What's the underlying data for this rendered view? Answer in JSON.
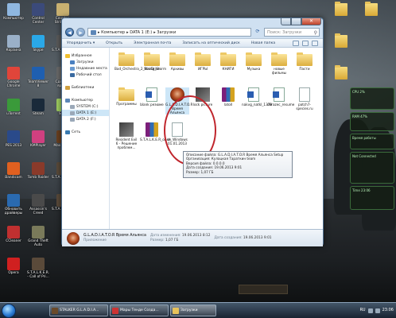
{
  "desktop_icons": [
    {
      "label": "Компьютер",
      "icon": "computer-icon"
    },
    {
      "label": "Control Center",
      "icon": "control-center-icon"
    },
    {
      "label": "Counter-Strike 1.6",
      "icon": "cs-icon"
    },
    {
      "label": "Корзина",
      "icon": "recycle-bin-icon"
    },
    {
      "label": "Skype",
      "icon": "skype-icon"
    },
    {
      "label": "S.T.A.L.K.E.R.",
      "icon": "stalker-icon"
    },
    {
      "label": "Google Chrome",
      "icon": "chrome-icon"
    },
    {
      "label": "TeamViewer 8",
      "icon": "teamviewer-icon"
    },
    {
      "label": "Сделать ярлык",
      "icon": "shortcut-icon"
    },
    {
      "label": "uTorrent",
      "icon": "utorrent-icon"
    },
    {
      "label": "Steam",
      "icon": "steam-icon"
    },
    {
      "label": "Sims",
      "icon": "sims-icon"
    },
    {
      "label": "PES 2013",
      "icon": "pes-icon"
    },
    {
      "label": "KMPlayer",
      "icon": "kmplayer-icon"
    },
    {
      "label": "Max Payne",
      "icon": "maxpayne-icon"
    },
    {
      "label": "Bandicam",
      "icon": "bandicam-icon"
    },
    {
      "label": "Tomb Raider",
      "icon": "tombraider-icon"
    },
    {
      "label": "S.T.A.L.K.E.R.",
      "icon": "stalker2-icon"
    },
    {
      "label": "Обновить драйверы",
      "icon": "drivers-icon"
    },
    {
      "label": "Assassin's Creed",
      "icon": "ac-icon"
    },
    {
      "label": "S.T.A.L.K.E.R.",
      "icon": "stalker3-icon"
    },
    {
      "label": "CCleaner",
      "icon": "ccleaner-icon"
    },
    {
      "label": "Grand Theft Auto",
      "icon": "gta-icon"
    },
    {
      "label": "Opera",
      "icon": "opera-icon"
    },
    {
      "label": "S.T.A.L.K.E.R. - Call of Pri...",
      "icon": "stalker4-icon"
    }
  ],
  "right_folders": [
    "",
    "",
    "",
    ""
  ],
  "window": {
    "address": [
      "Компьютер",
      "DATA 1 (E:)",
      "Загрузки"
    ],
    "search_placeholder": "Поиск: Загрузки",
    "toolbar": [
      "Упорядочить ▾",
      "Открыть",
      "Электронная почта",
      "Записать на оптический диск",
      "Новая папка"
    ],
    "nav": [
      {
        "label": "Избранное",
        "icon": "star-icon",
        "sel": false
      },
      {
        "label": "Загрузки",
        "icon": "downloads-icon",
        "sel": false
      },
      {
        "label": "Недавние места",
        "icon": "recent-icon",
        "sel": false
      },
      {
        "label": "Рабочий стол",
        "icon": "desktop-icon",
        "sel": false
      },
      {
        "label": "",
        "icon": "",
        "sel": false
      },
      {
        "label": "Библиотеки",
        "icon": "library-icon",
        "sel": false
      },
      {
        "label": "",
        "icon": "",
        "sel": false
      },
      {
        "label": "Компьютер",
        "icon": "computer-icon",
        "sel": false
      },
      {
        "label": "SYSTEM (C:)",
        "icon": "drive-icon",
        "sel": false
      },
      {
        "label": "DATA 1 (E:)",
        "icon": "drive-icon",
        "sel": true
      },
      {
        "label": "DATA 2 (F:)",
        "icon": "drive-icon",
        "sel": false
      },
      {
        "label": "",
        "icon": "",
        "sel": false
      },
      {
        "label": "Сеть",
        "icon": "network-icon",
        "sel": false
      }
    ],
    "files": [
      {
        "label": "Bad_Orchestra_2_Rising_Storm",
        "type": "folder"
      },
      {
        "label": "StarDrive",
        "type": "folder"
      },
      {
        "label": "Архивы",
        "type": "folder"
      },
      {
        "label": "ИГРЫ",
        "type": "folder"
      },
      {
        "label": "КНИГИ",
        "type": "folder"
      },
      {
        "label": "Музыка",
        "type": "folder"
      },
      {
        "label": "новые фильмы",
        "type": "folder"
      },
      {
        "label": "Пасти",
        "type": "folder"
      },
      {
        "label": "Программы",
        "type": "folder"
      },
      {
        "label": "blank резюме",
        "type": "word"
      },
      {
        "label": "G.L.A.D.I.A.T.O.R Время Альянса",
        "type": "game"
      },
      {
        "label": "lock picture",
        "type": "thumb"
      },
      {
        "label": "latoll",
        "type": "rar"
      },
      {
        "label": "nakvg_natkl_1379",
        "type": "word"
      },
      {
        "label": "obrazec_resume",
        "type": "word"
      },
      {
        "label": "patch7-species.ru",
        "type": "doc"
      },
      {
        "label": "Resident Evil 6 - Решение проблем...",
        "type": "thumb"
      },
      {
        "label": "S.T.A.L.K.E.R_obse",
        "type": "rar"
      },
      {
        "label": "sh_Windows 01.01.2013",
        "type": "doc"
      }
    ],
    "tooltip": [
      "Описание файла: G.L.A.D.I.A.T.O.R Время Альянса Setup",
      "Организация: Кулацкая Тараткин team",
      "Версия файла: 0.0.0.0",
      "Дата создания: 19.06.2013 9:01",
      "Размер: 1,07 ГБ"
    ],
    "details": {
      "name": "G.L.A.D.I.A.T.O.R Время Альянса",
      "modified_label": "Дата изменения:",
      "modified": "19.06.2013 8:12",
      "created_label": "Дата создания:",
      "created": "19.06.2013 9:01",
      "kind": "Приложение",
      "size_label": "Размер:",
      "size": "1,07 ГБ"
    }
  },
  "gadgets": [
    "CPU 2%",
    "RAM 47%",
    "Время работы",
    "Not Connected",
    "Time 23:06"
  ],
  "taskbar": {
    "buttons": [
      {
        "label": "STALKER G.L.A.D.I.A...",
        "icon": "stalker-task-icon"
      },
      {
        "label": "Мары Тенде Созда...",
        "icon": "browser-task-icon"
      },
      {
        "label": "Загрузки",
        "icon": "explorer-task-icon"
      }
    ],
    "lang": "RU",
    "time": "23:06"
  }
}
